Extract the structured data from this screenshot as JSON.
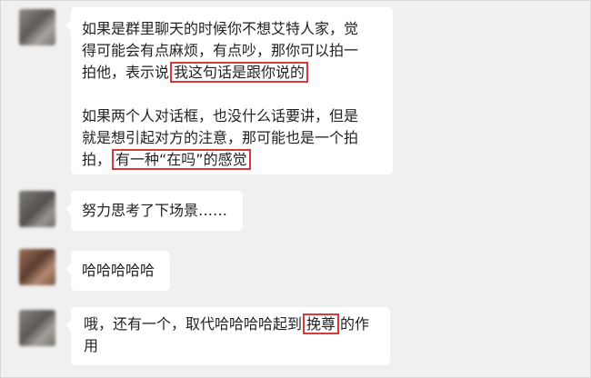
{
  "messages": [
    {
      "paragraphs": [
        {
          "lines": [
            "如果是群里聊天的时候你不想艾特人家，觉",
            "得可能会有点麻烦，有点吵，那你可以拍一"
          ],
          "tail_before": "拍他，表示说",
          "tail_highlight": "我这句话是跟你说的"
        },
        {
          "lines": [
            "如果两个人对话框，也没什么话要讲，但是",
            "就是想引起对方的注意，那可能也是一个拍"
          ],
          "tail_before": "拍，",
          "tail_highlight": "有一种“在吗”的感觉"
        }
      ]
    },
    {
      "text": "努力思考了下场景……"
    },
    {
      "text": "哈哈哈哈哈"
    },
    {
      "before": "哦，还有一个，取代哈哈哈哈起到",
      "highlight": "挽尊",
      "after": "的作",
      "line2": "用"
    }
  ]
}
